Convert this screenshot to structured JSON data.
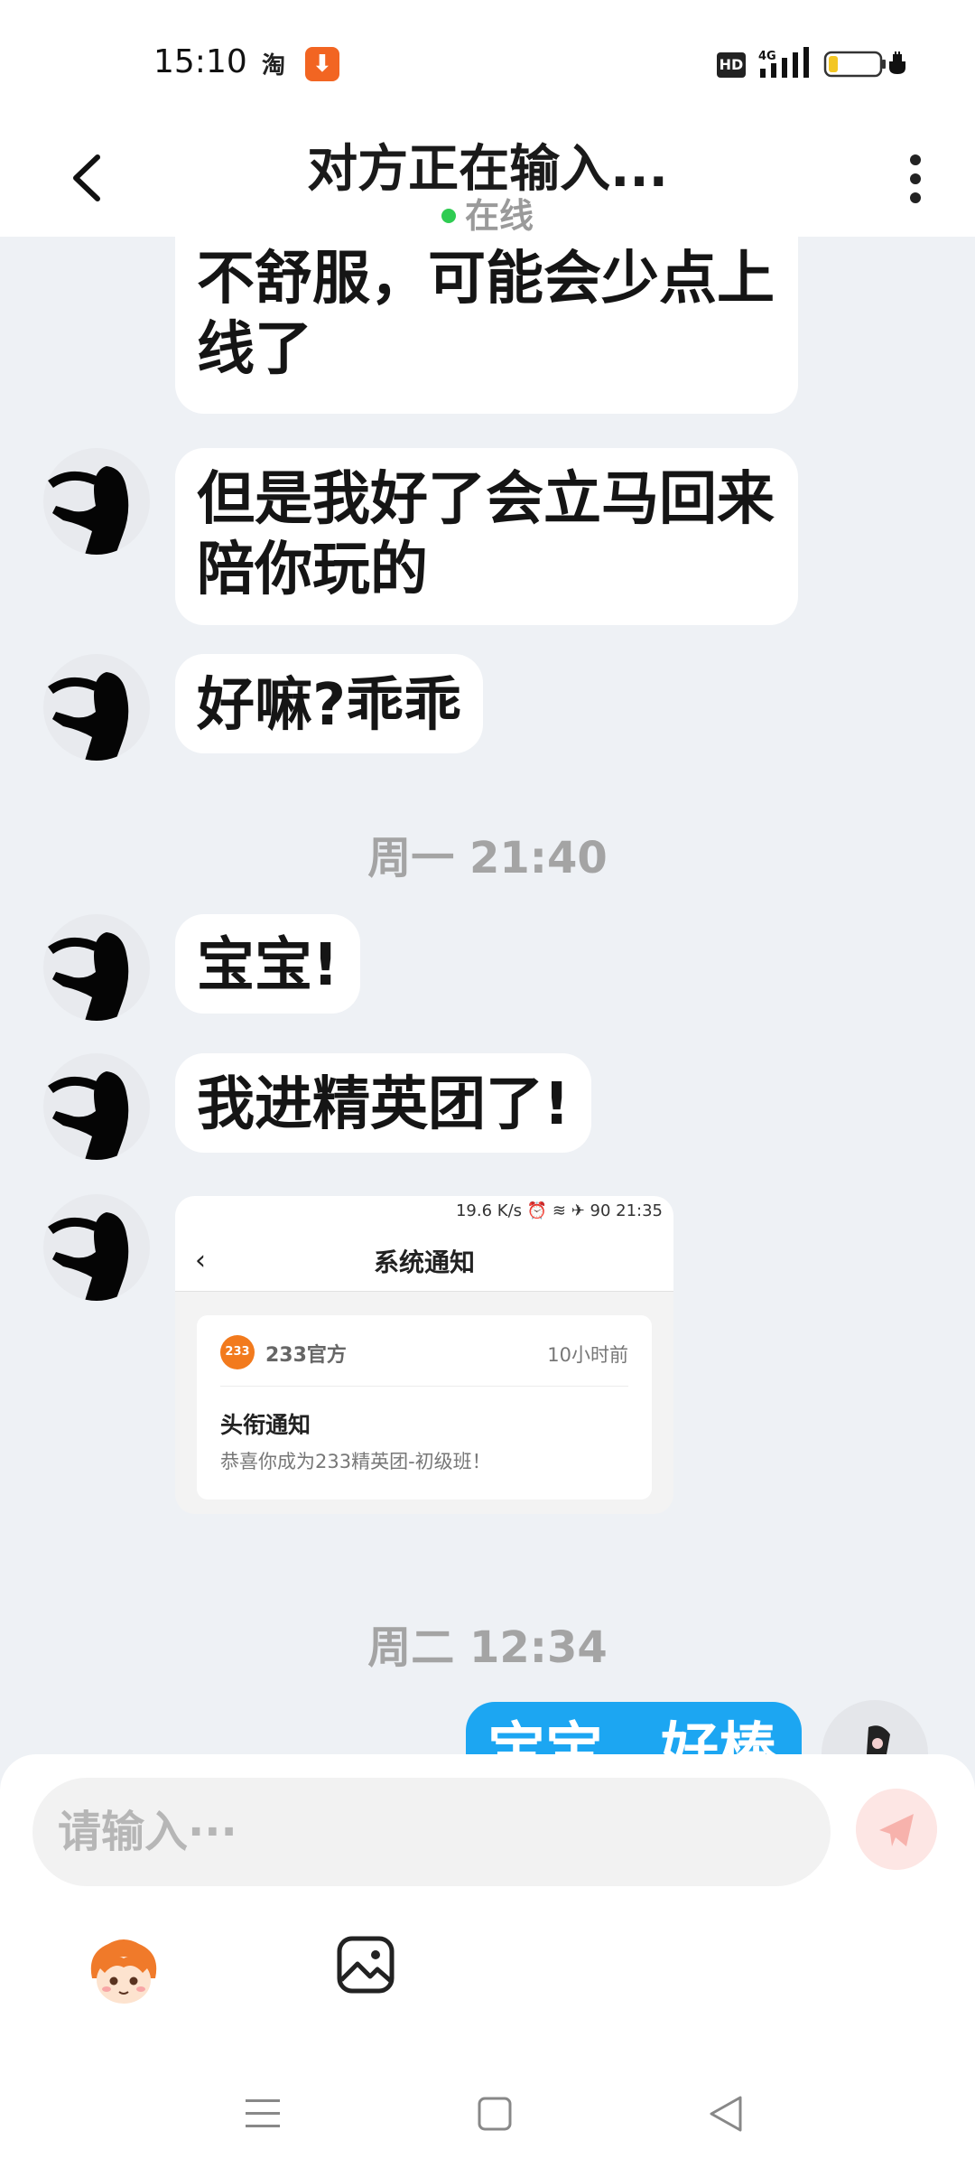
{
  "status_bar": {
    "time": "15:10",
    "taobao_icon_label": "淘",
    "download_icon_label": "⬇",
    "hd_label": "HD",
    "network_label": "4G",
    "icons": [
      "taobao-icon",
      "download-icon",
      "hd-icon",
      "signal-icon",
      "battery-icon",
      "charging-icon"
    ]
  },
  "header": {
    "title": "对方正在输入...",
    "status": "在线",
    "status_color": "#2fcc52",
    "icons": [
      "back-arrow-icon",
      "more-dots-icon"
    ]
  },
  "messages": [
    {
      "type": "incoming",
      "text": "不舒服，可能会少点上\n线了"
    },
    {
      "type": "incoming",
      "text": "但是我好了会立马回来\n陪你玩的"
    },
    {
      "type": "incoming",
      "text": "好嘛?乖乖"
    },
    {
      "type": "time",
      "text": "周一 21:40"
    },
    {
      "type": "incoming",
      "text": "宝宝!"
    },
    {
      "type": "incoming",
      "text": "我进精英团了!"
    },
    {
      "type": "incoming-image",
      "screenshot": {
        "status_text": "19.6 K/s ⏰ ≋ ✈ 90 21:35",
        "back_glyph": "‹",
        "title": "系统通知",
        "logo_text": "233",
        "source": "233官方",
        "time_ago": "10小时前",
        "heading": "头衔通知",
        "body": "恭喜你成为233精英团-初级班！"
      }
    },
    {
      "type": "time",
      "text": "周二 12:34"
    },
    {
      "type": "outgoing",
      "text": "宝宝，好棒"
    }
  ],
  "input_panel": {
    "placeholder": "请输入···",
    "tools": [
      "emoji-mascot-icon",
      "image-icon"
    ],
    "send_icon": "paper-plane-icon"
  },
  "nav_bar": {
    "icons": [
      "menu-icon",
      "home-square-icon",
      "back-triangle-icon"
    ]
  },
  "colors": {
    "chat_background": "#eef1f5",
    "outgoing_bubble": "#1ca6f2",
    "incoming_bubble": "#ffffff",
    "send_button": "#fde6e4"
  }
}
